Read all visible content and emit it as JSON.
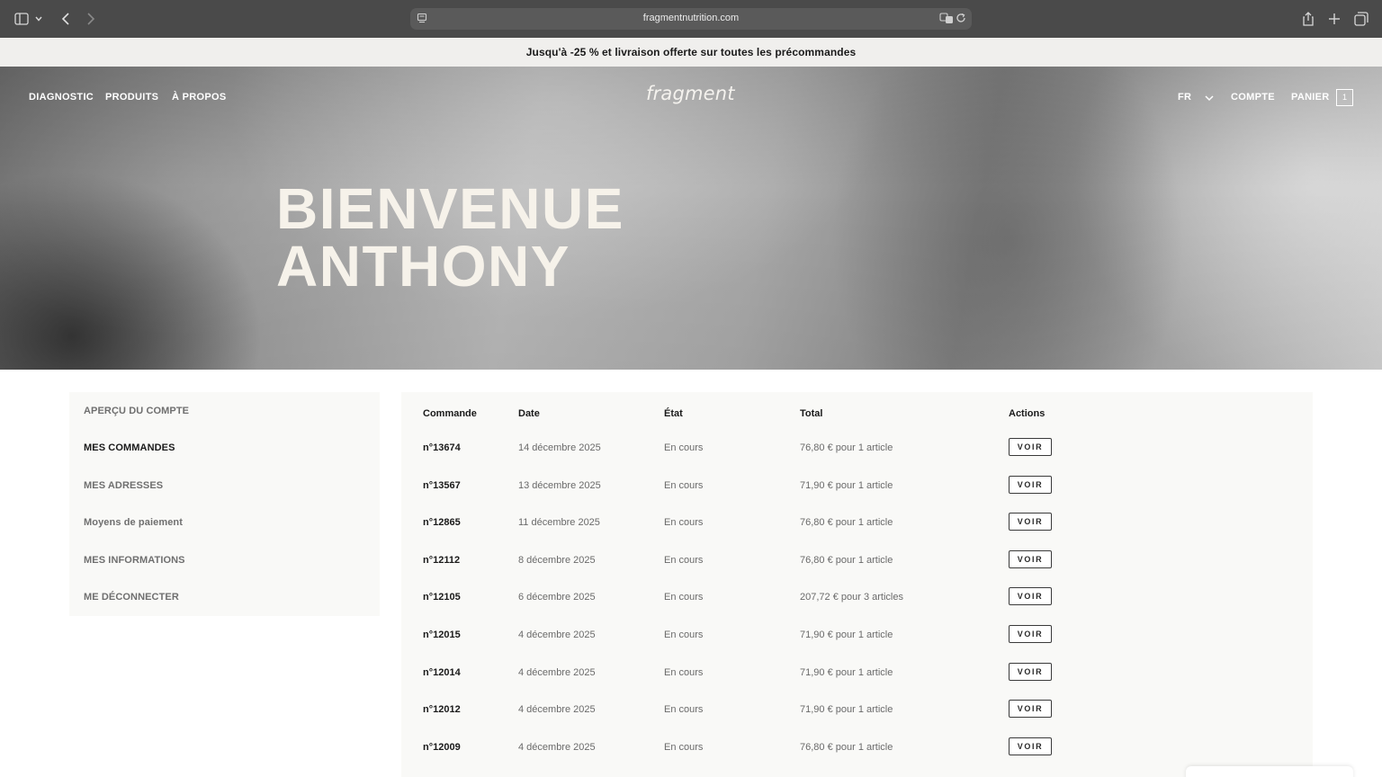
{
  "browser": {
    "url": "fragmentnutrition.com",
    "icons": [
      "sidebar-icon",
      "chevron-down-icon",
      "back-icon",
      "forward-icon",
      "reader-icon",
      "translate-icon",
      "reload-icon",
      "share-icon",
      "new-tab-icon",
      "tabs-icon"
    ]
  },
  "promo": {
    "text": "Jusqu'à -25 % et livraison offerte sur toutes les précommandes"
  },
  "header": {
    "nav": [
      "DIAGNOSTIC",
      "PRODUITS",
      "À PROPOS"
    ],
    "logo": "fragment",
    "language": "FR",
    "account": "COMPTE",
    "cart": "PANIER",
    "cart_count": "1"
  },
  "hero": {
    "line1": "BIENVENUE",
    "line2": "ANTHONY"
  },
  "sidebar": {
    "items": [
      {
        "label": "APERÇU DU COMPTE",
        "active": false
      },
      {
        "label": "MES COMMANDES",
        "active": true
      },
      {
        "label": "MES ADRESSES",
        "active": false
      },
      {
        "label": "Moyens de paiement",
        "active": false
      },
      {
        "label": "MES INFORMATIONS",
        "active": false
      },
      {
        "label": "ME DÉCONNECTER",
        "active": false
      }
    ]
  },
  "orders": {
    "headers": {
      "order": "Commande",
      "date": "Date",
      "state": "État",
      "total": "Total",
      "actions": "Actions"
    },
    "action_label": "VOIR",
    "rows": [
      {
        "order": "n°13674",
        "date": "14 décembre 2025",
        "state": "En cours",
        "total": "76,80 € pour 1 article"
      },
      {
        "order": "n°13567",
        "date": "13 décembre 2025",
        "state": "En cours",
        "total": "71,90 € pour 1 article"
      },
      {
        "order": "n°12865",
        "date": "11 décembre 2025",
        "state": "En cours",
        "total": "76,80 € pour 1 article"
      },
      {
        "order": "n°12112",
        "date": "8 décembre 2025",
        "state": "En cours",
        "total": "76,80 € pour 1 article"
      },
      {
        "order": "n°12105",
        "date": "6 décembre 2025",
        "state": "En cours",
        "total": "207,72 € pour 3 articles"
      },
      {
        "order": "n°12015",
        "date": "4 décembre 2025",
        "state": "En cours",
        "total": "71,90 € pour 1 article"
      },
      {
        "order": "n°12014",
        "date": "4 décembre 2025",
        "state": "En cours",
        "total": "71,90 € pour 1 article"
      },
      {
        "order": "n°12012",
        "date": "4 décembre 2025",
        "state": "En cours",
        "total": "71,90 € pour 1 article"
      },
      {
        "order": "n°12009",
        "date": "4 décembre 2025",
        "state": "En cours",
        "total": "76,80 € pour 1 article"
      }
    ]
  }
}
